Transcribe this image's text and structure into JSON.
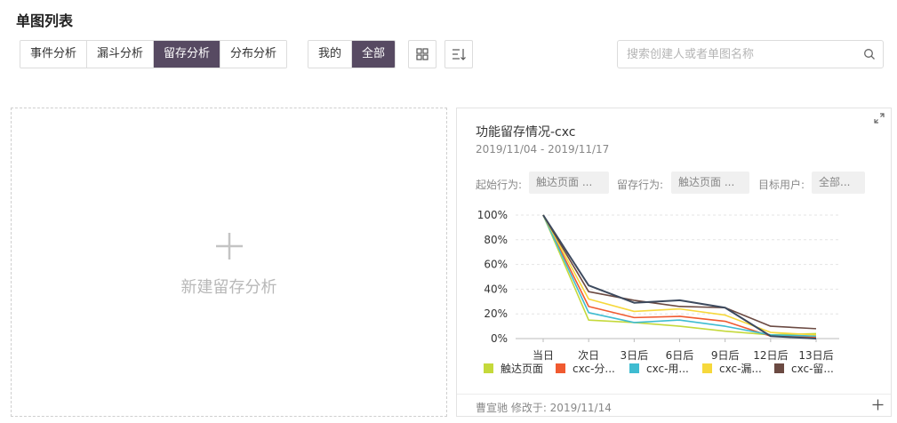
{
  "header": {
    "title": "单图列表"
  },
  "type_tabs": [
    {
      "label": "事件分析",
      "active": false
    },
    {
      "label": "漏斗分析",
      "active": false
    },
    {
      "label": "留存分析",
      "active": true
    },
    {
      "label": "分布分析",
      "active": false
    }
  ],
  "owner_tabs": [
    {
      "label": "我的",
      "active": false
    },
    {
      "label": "全部",
      "active": true
    }
  ],
  "toolbar": {
    "grid_icon": "grid-view-icon",
    "sort_icon": "sort-icon"
  },
  "search": {
    "placeholder": "搜索创建人或者单图名称",
    "value": "",
    "icon": "search-icon"
  },
  "new_card": {
    "label": "新建留存分析",
    "icon": "plus-icon"
  },
  "chart_card": {
    "title": "功能留存情况-cxc",
    "date_range": "2019/11/04 - 2019/11/17",
    "filters": {
      "start_label": "起始行为:",
      "start_value": "触达页面 ...",
      "retain_label": "留存行为:",
      "retain_value": "触达页面 ...",
      "user_label": "目标用户:",
      "user_value": "全部..."
    },
    "footer": "曹宣驰 修改于: 2019/11/14"
  },
  "chart_data": {
    "type": "line",
    "categories": [
      "当日",
      "次日",
      "3日后",
      "6日后",
      "9日后",
      "12日后",
      "13日后"
    ],
    "ylim": [
      0,
      100
    ],
    "y_ticks": [
      "0%",
      "20%",
      "40%",
      "60%",
      "80%",
      "100%"
    ],
    "series": [
      {
        "name": "触达页面",
        "color": "#c5d93b",
        "values": [
          100,
          15,
          13,
          10,
          6,
          3,
          4
        ]
      },
      {
        "name": "cxc-分...",
        "color": "#f05a30",
        "values": [
          100,
          26,
          17,
          18,
          14,
          2,
          1
        ]
      },
      {
        "name": "cxc-用...",
        "color": "#3fbcd1",
        "values": [
          100,
          21,
          13,
          15,
          10,
          3,
          2
        ]
      },
      {
        "name": "cxc-漏...",
        "color": "#f6d83b",
        "values": [
          100,
          32,
          22,
          24,
          19,
          5,
          3
        ]
      },
      {
        "name": "cxc-留...",
        "color": "#6b4a42",
        "values": [
          100,
          38,
          31,
          26,
          25,
          10,
          8
        ]
      },
      {
        "name": "",
        "color": "#3d4a5e",
        "values": [
          100,
          43,
          29,
          31,
          25,
          2,
          0
        ]
      }
    ],
    "grid": true
  }
}
